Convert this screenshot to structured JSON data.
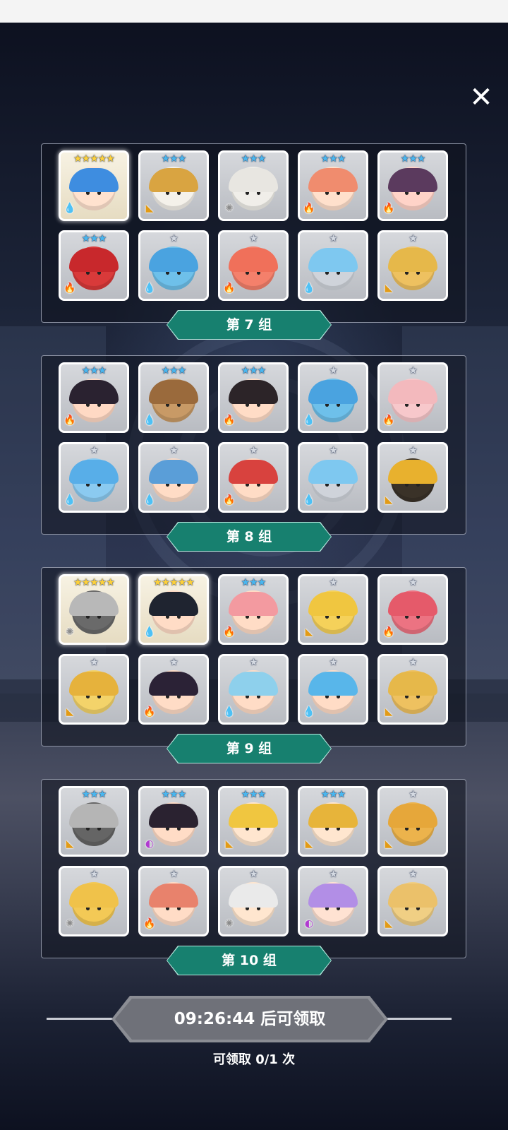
{
  "close_icon_glyph": "✕",
  "groups": [
    {
      "label": "第 7 组",
      "cards": [
        {
          "stars": "★★★★★",
          "star_color": "gold",
          "quality": "q5",
          "element": "water",
          "hair": "#3e8de0",
          "skin": "#ffe2cf"
        },
        {
          "stars": "★★★",
          "star_color": "blue",
          "quality": "q3",
          "element": "wind",
          "hair": "#d9a441",
          "skin": "#f4f1ea"
        },
        {
          "stars": "★★★",
          "star_color": "blue",
          "quality": "q3",
          "element": "light",
          "hair": "#e8e6e1",
          "skin": "#f0eee9"
        },
        {
          "stars": "★★★",
          "star_color": "blue",
          "quality": "q3",
          "element": "fire",
          "hair": "#f08c6e",
          "skin": "#ffe0cc"
        },
        {
          "stars": "★★★",
          "star_color": "blue",
          "quality": "q3",
          "element": "fire",
          "hair": "#5b3a5e",
          "skin": "#ffd3c8"
        },
        {
          "stars": "★★★",
          "star_color": "blue",
          "quality": "q3",
          "element": "fire",
          "hair": "#c8282c",
          "skin": "#d93a3a"
        },
        {
          "stars": "★",
          "star_color": "silver",
          "quality": "q3",
          "element": "water",
          "hair": "#4aa3e0",
          "skin": "#6ec0ea"
        },
        {
          "stars": "★",
          "star_color": "silver",
          "quality": "q3",
          "element": "fire",
          "hair": "#f0705a",
          "skin": "#f4806b"
        },
        {
          "stars": "★",
          "star_color": "silver",
          "quality": "q3",
          "element": "water",
          "hair": "#7ec8f0",
          "skin": "#cfd3da"
        },
        {
          "stars": "★",
          "star_color": "silver",
          "quality": "q3",
          "element": "wind",
          "hair": "#e6b84a",
          "skin": "#eec160"
        }
      ]
    },
    {
      "label": "第 8 组",
      "cards": [
        {
          "stars": "★★★",
          "star_color": "blue",
          "quality": "q3",
          "element": "fire",
          "hair": "#2a2230",
          "skin": "#ffd9c4"
        },
        {
          "stars": "★★★",
          "star_color": "blue",
          "quality": "q3",
          "element": "water",
          "hair": "#9a6a3c",
          "skin": "#c89a66"
        },
        {
          "stars": "★★★",
          "star_color": "blue",
          "quality": "q3",
          "element": "fire",
          "hair": "#2c2428",
          "skin": "#ffdcc6"
        },
        {
          "stars": "★",
          "star_color": "silver",
          "quality": "q3",
          "element": "water",
          "hair": "#4aa3e0",
          "skin": "#6ec0ea"
        },
        {
          "stars": "★",
          "star_color": "silver",
          "quality": "q3",
          "element": "fire",
          "hair": "#f3b9bd",
          "skin": "#f7c8cb"
        },
        {
          "stars": "★",
          "star_color": "silver",
          "quality": "q3",
          "element": "water",
          "hair": "#58aee8",
          "skin": "#8bcaf0"
        },
        {
          "stars": "★",
          "star_color": "silver",
          "quality": "q3",
          "element": "water",
          "hair": "#5a9ed8",
          "skin": "#ffdcc6"
        },
        {
          "stars": "★",
          "star_color": "silver",
          "quality": "q3",
          "element": "fire",
          "hair": "#d8423e",
          "skin": "#ffdcc6"
        },
        {
          "stars": "★",
          "star_color": "silver",
          "quality": "q3",
          "element": "water",
          "hair": "#7ec8f0",
          "skin": "#cfd3da"
        },
        {
          "stars": "★",
          "star_color": "silver",
          "quality": "q3",
          "element": "wind",
          "hair": "#e8b12e",
          "skin": "#3a3228"
        }
      ]
    },
    {
      "label": "第 9 组",
      "cards": [
        {
          "stars": "★★★★★",
          "star_color": "gold",
          "quality": "q5",
          "element": "light",
          "hair": "#b8b8b8",
          "skin": "#6a6a6a"
        },
        {
          "stars": "★★★★★",
          "star_color": "gold",
          "quality": "q5",
          "element": "water",
          "hair": "#1f2430",
          "skin": "#ffdcc6"
        },
        {
          "stars": "★★★",
          "star_color": "blue",
          "quality": "q3",
          "element": "fire",
          "hair": "#f39aa0",
          "skin": "#ffdcc6"
        },
        {
          "stars": "★",
          "star_color": "silver",
          "quality": "q3",
          "element": "wind",
          "hair": "#f0c640",
          "skin": "#f5d15a"
        },
        {
          "stars": "★",
          "star_color": "silver",
          "quality": "q3",
          "element": "fire",
          "hair": "#e55a6a",
          "skin": "#ec7382"
        },
        {
          "stars": "★",
          "star_color": "silver",
          "quality": "q3",
          "element": "wind",
          "hair": "#e6b23c",
          "skin": "#f3d36a"
        },
        {
          "stars": "★",
          "star_color": "silver",
          "quality": "q3",
          "element": "fire",
          "hair": "#2b2236",
          "skin": "#ffdcc6"
        },
        {
          "stars": "★",
          "star_color": "silver",
          "quality": "q3",
          "element": "water",
          "hair": "#8ed0ec",
          "skin": "#ffdcc6"
        },
        {
          "stars": "★",
          "star_color": "silver",
          "quality": "q3",
          "element": "water",
          "hair": "#58b6ea",
          "skin": "#ffdcc6"
        },
        {
          "stars": "★",
          "star_color": "silver",
          "quality": "q3",
          "element": "wind",
          "hair": "#e6b84a",
          "skin": "#eec160"
        }
      ]
    },
    {
      "label": "第 10 组",
      "cards": [
        {
          "stars": "★★★",
          "star_color": "blue",
          "quality": "q3",
          "element": "wind",
          "hair": "#b5b5b5",
          "skin": "#656565"
        },
        {
          "stars": "★★★",
          "star_color": "blue",
          "quality": "q3",
          "element": "dark",
          "hair": "#2a2230",
          "skin": "#ffdcc6"
        },
        {
          "stars": "★★★",
          "star_color": "blue",
          "quality": "q3",
          "element": "wind",
          "hair": "#f0c640",
          "skin": "#ffe6cf"
        },
        {
          "stars": "★★★",
          "star_color": "blue",
          "quality": "q3",
          "element": "wind",
          "hair": "#e7b43a",
          "skin": "#ffe6cf"
        },
        {
          "stars": "★",
          "star_color": "silver",
          "quality": "q3",
          "element": "wind",
          "hair": "#e6a73a",
          "skin": "#ecb34c"
        },
        {
          "stars": "★",
          "star_color": "silver",
          "quality": "q3",
          "element": "light",
          "hair": "#f0c24a",
          "skin": "#f3c956"
        },
        {
          "stars": "★",
          "star_color": "silver",
          "quality": "q3",
          "element": "fire",
          "hair": "#e8826c",
          "skin": "#ffdcc6"
        },
        {
          "stars": "★",
          "star_color": "silver",
          "quality": "q3",
          "element": "light",
          "hair": "#eaeaea",
          "skin": "#ffe6cf"
        },
        {
          "stars": "★",
          "star_color": "silver",
          "quality": "q3",
          "element": "dark",
          "hair": "#b28ee6",
          "skin": "#ffe2d2"
        },
        {
          "stars": "★",
          "star_color": "silver",
          "quality": "q3",
          "element": "wind",
          "hair": "#ebc16a",
          "skin": "#f0cf84"
        }
      ]
    }
  ],
  "element_icons": {
    "water": {
      "glyph": "💧",
      "name": "water-element-icon"
    },
    "fire": {
      "glyph": "🔥",
      "name": "fire-element-icon"
    },
    "wind": {
      "glyph": "◣",
      "name": "wind-element-icon"
    },
    "light": {
      "glyph": "✺",
      "name": "light-element-icon"
    },
    "dark": {
      "glyph": "◐",
      "name": "dark-element-icon"
    }
  },
  "timer_text": "09:26:44 后可领取",
  "claim_count_text": "可领取 0/1 次",
  "colors": {
    "banner": "#17806f",
    "timer_plate": "#6f7179",
    "star_blue": "#49b7f0",
    "star_gold": "#ffd23a"
  }
}
